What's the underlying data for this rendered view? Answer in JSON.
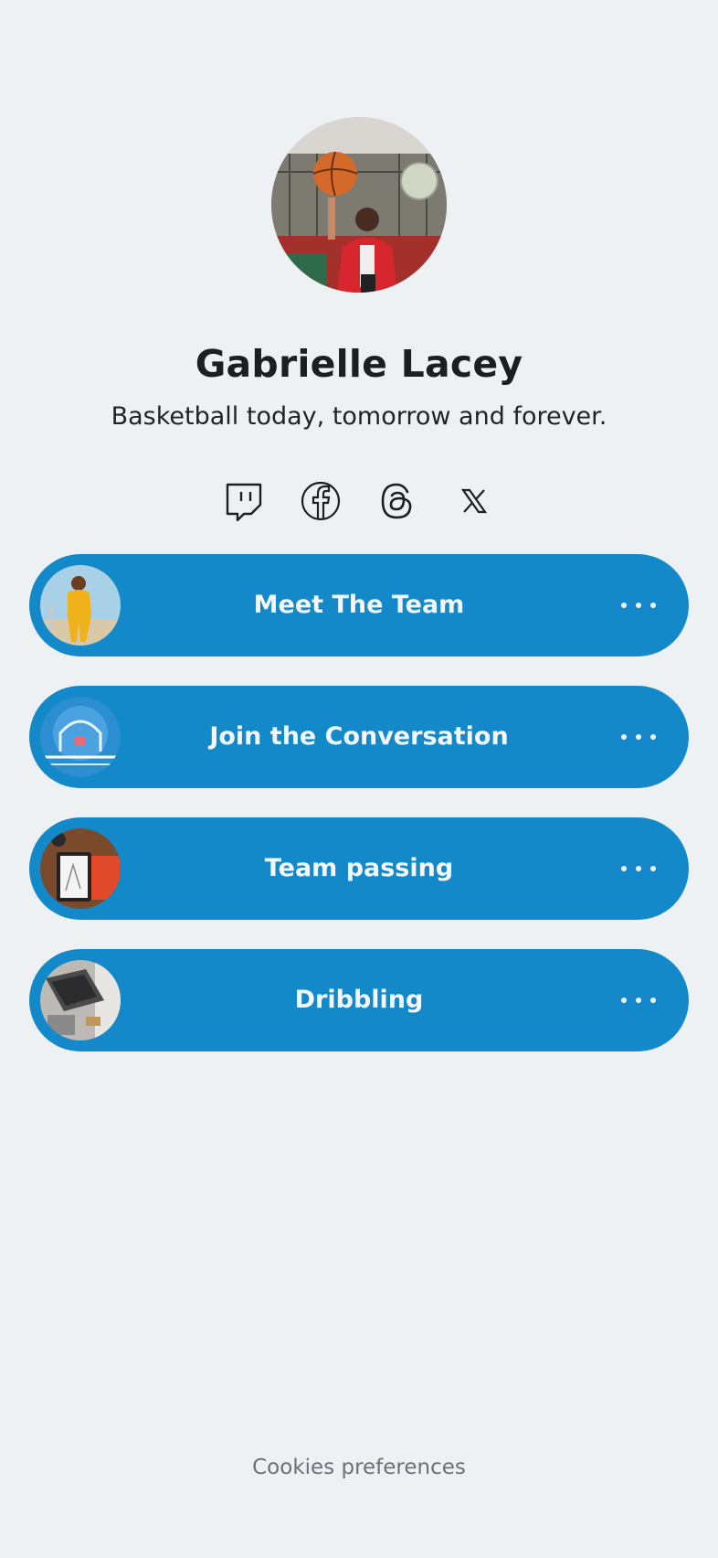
{
  "profile": {
    "name": "Gabrielle Lacey",
    "bio": "Basketball today, tomorrow and forever.",
    "avatar_icon": "avatar-photo"
  },
  "socials": [
    {
      "name": "Twitch",
      "icon": "twitch-icon"
    },
    {
      "name": "Facebook",
      "icon": "facebook-icon"
    },
    {
      "name": "Threads",
      "icon": "threads-icon"
    },
    {
      "name": "X",
      "icon": "x-icon"
    }
  ],
  "links": [
    {
      "label": "Meet The Team",
      "thumbnail": "yellow-outfit-photo"
    },
    {
      "label": "Join the Conversation",
      "thumbnail": "basketball-hoop-photo"
    },
    {
      "label": "Team passing",
      "thumbnail": "tablet-desk-photo"
    },
    {
      "label": "Dribbling",
      "thumbnail": "laptop-desk-photo"
    }
  ],
  "footer": {
    "cookies_label": "Cookies preferences"
  },
  "colors": {
    "background": "#eef1f4",
    "button": "#1389c9",
    "button_text": "#f2f7fb",
    "text": "#1b1e22",
    "muted": "#6c7076"
  }
}
